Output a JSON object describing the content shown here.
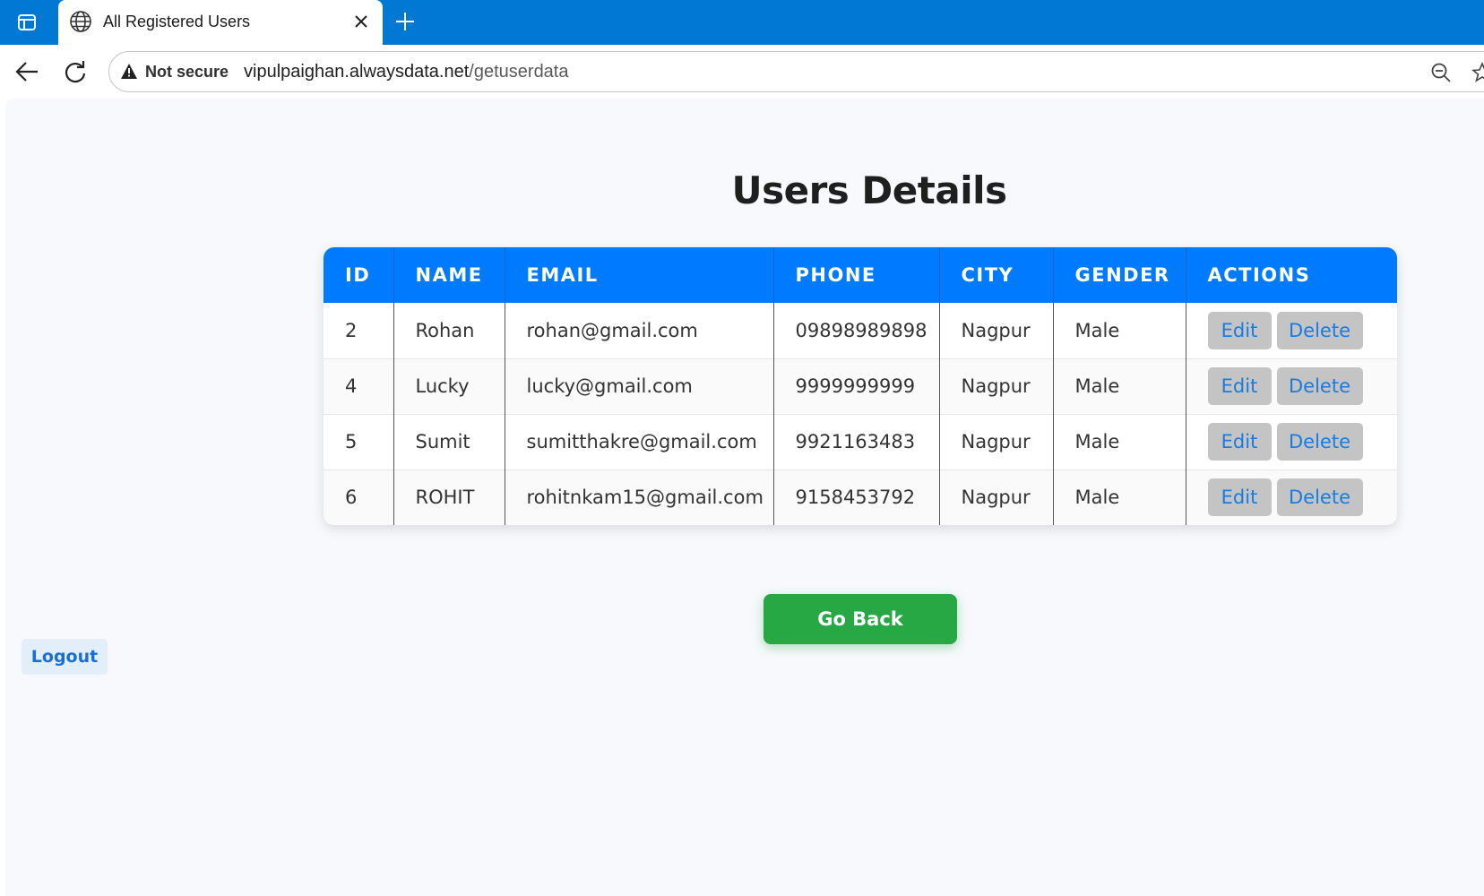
{
  "browser": {
    "tab_title": "All Registered Users",
    "security_label": "Not secure",
    "url_host": "vipulpaighan.alwaysdata.net",
    "url_path": "/getuserdata"
  },
  "page": {
    "title": "Users Details",
    "go_back_label": "Go Back",
    "logout_label": "Logout"
  },
  "table": {
    "headers": [
      "ID",
      "NAME",
      "EMAIL",
      "PHONE",
      "CITY",
      "GENDER",
      "ACTIONS"
    ],
    "edit_label": "Edit",
    "delete_label": "Delete",
    "rows": [
      {
        "id": "2",
        "name": "Rohan",
        "email": "rohan@gmail.com",
        "phone": "09898989898",
        "city": "Nagpur",
        "gender": "Male"
      },
      {
        "id": "4",
        "name": "Lucky",
        "email": "lucky@gmail.com",
        "phone": "9999999999",
        "city": "Nagpur",
        "gender": "Male"
      },
      {
        "id": "5",
        "name": "Sumit",
        "email": "sumitthakre@gmail.com",
        "phone": "9921163483",
        "city": "Nagpur",
        "gender": "Male"
      },
      {
        "id": "6",
        "name": "ROHIT",
        "email": "rohitnkam15@gmail.com",
        "phone": "9158453792",
        "city": "Nagpur",
        "gender": "Male"
      }
    ]
  },
  "colors": {
    "browser_accent": "#0078d4",
    "table_header": "#007bff",
    "go_back": "#28a745",
    "action_text": "#1a7be0"
  },
  "icons": [
    "sidebar-toggle-icon",
    "globe-icon",
    "close-icon",
    "plus-icon",
    "back-arrow-icon",
    "reload-icon",
    "warning-icon",
    "zoom-icon",
    "star-icon"
  ]
}
